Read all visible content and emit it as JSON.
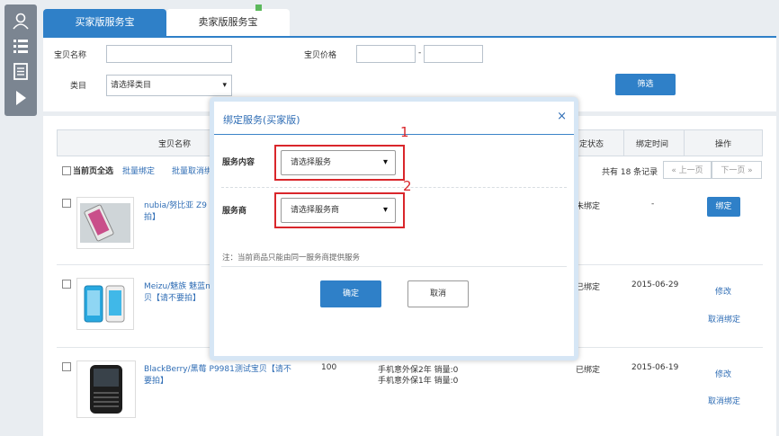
{
  "tabs": {
    "buyer": "买家版服务宝",
    "seller": "卖家版服务宝"
  },
  "filter": {
    "name_label": "宝贝名称",
    "price_label": "宝贝价格",
    "price_sep": "-",
    "category_label": "类目",
    "category_value": "请选择类目",
    "filter_button": "筛选"
  },
  "table": {
    "headers": {
      "name": "宝贝名称",
      "status": "定状态",
      "time": "绑定时间",
      "action": "操作"
    },
    "select_all": "当前页全选",
    "bulk_bind": "批量绑定",
    "bulk_unbind": "批量取消绑",
    "total": "共有 18 条记录",
    "prev": "« 上一页",
    "next": "下一页 »",
    "rows": [
      {
        "title": "nubia/努比亚 Z9 r",
        "title2": "拍】",
        "status": "未绑定",
        "time": "-",
        "action": "绑定"
      },
      {
        "title": "Meizu/魅族 魅蓝no",
        "title2": "贝【请不要拍】",
        "status": "已绑定",
        "time": "2015-06-29",
        "action": "修改",
        "action2": "取消绑定"
      },
      {
        "title": "BlackBerry/黑莓 P9981测试宝贝【请不",
        "title2": "要拍】",
        "price": "100",
        "service1": "手机意外保2年 销量:0",
        "service2": "手机意外保1年 销量:0",
        "status": "已绑定",
        "time": "2015-06-19",
        "action": "修改",
        "action2": "取消绑定"
      }
    ]
  },
  "modal": {
    "title": "绑定服务(买家版)",
    "close": "×",
    "content_label": "服务内容",
    "content_value": "请选择服务",
    "provider_label": "服务商",
    "provider_value": "请选择服务商",
    "note": "注：当前商品只能由同一服务商提供服务",
    "confirm": "确定",
    "cancel": "取消"
  },
  "annotations": {
    "one": "1",
    "two": "2"
  },
  "colors": {
    "accent": "#2f80c8",
    "annotation": "#d9262b",
    "sidebar": "#7b8591"
  }
}
